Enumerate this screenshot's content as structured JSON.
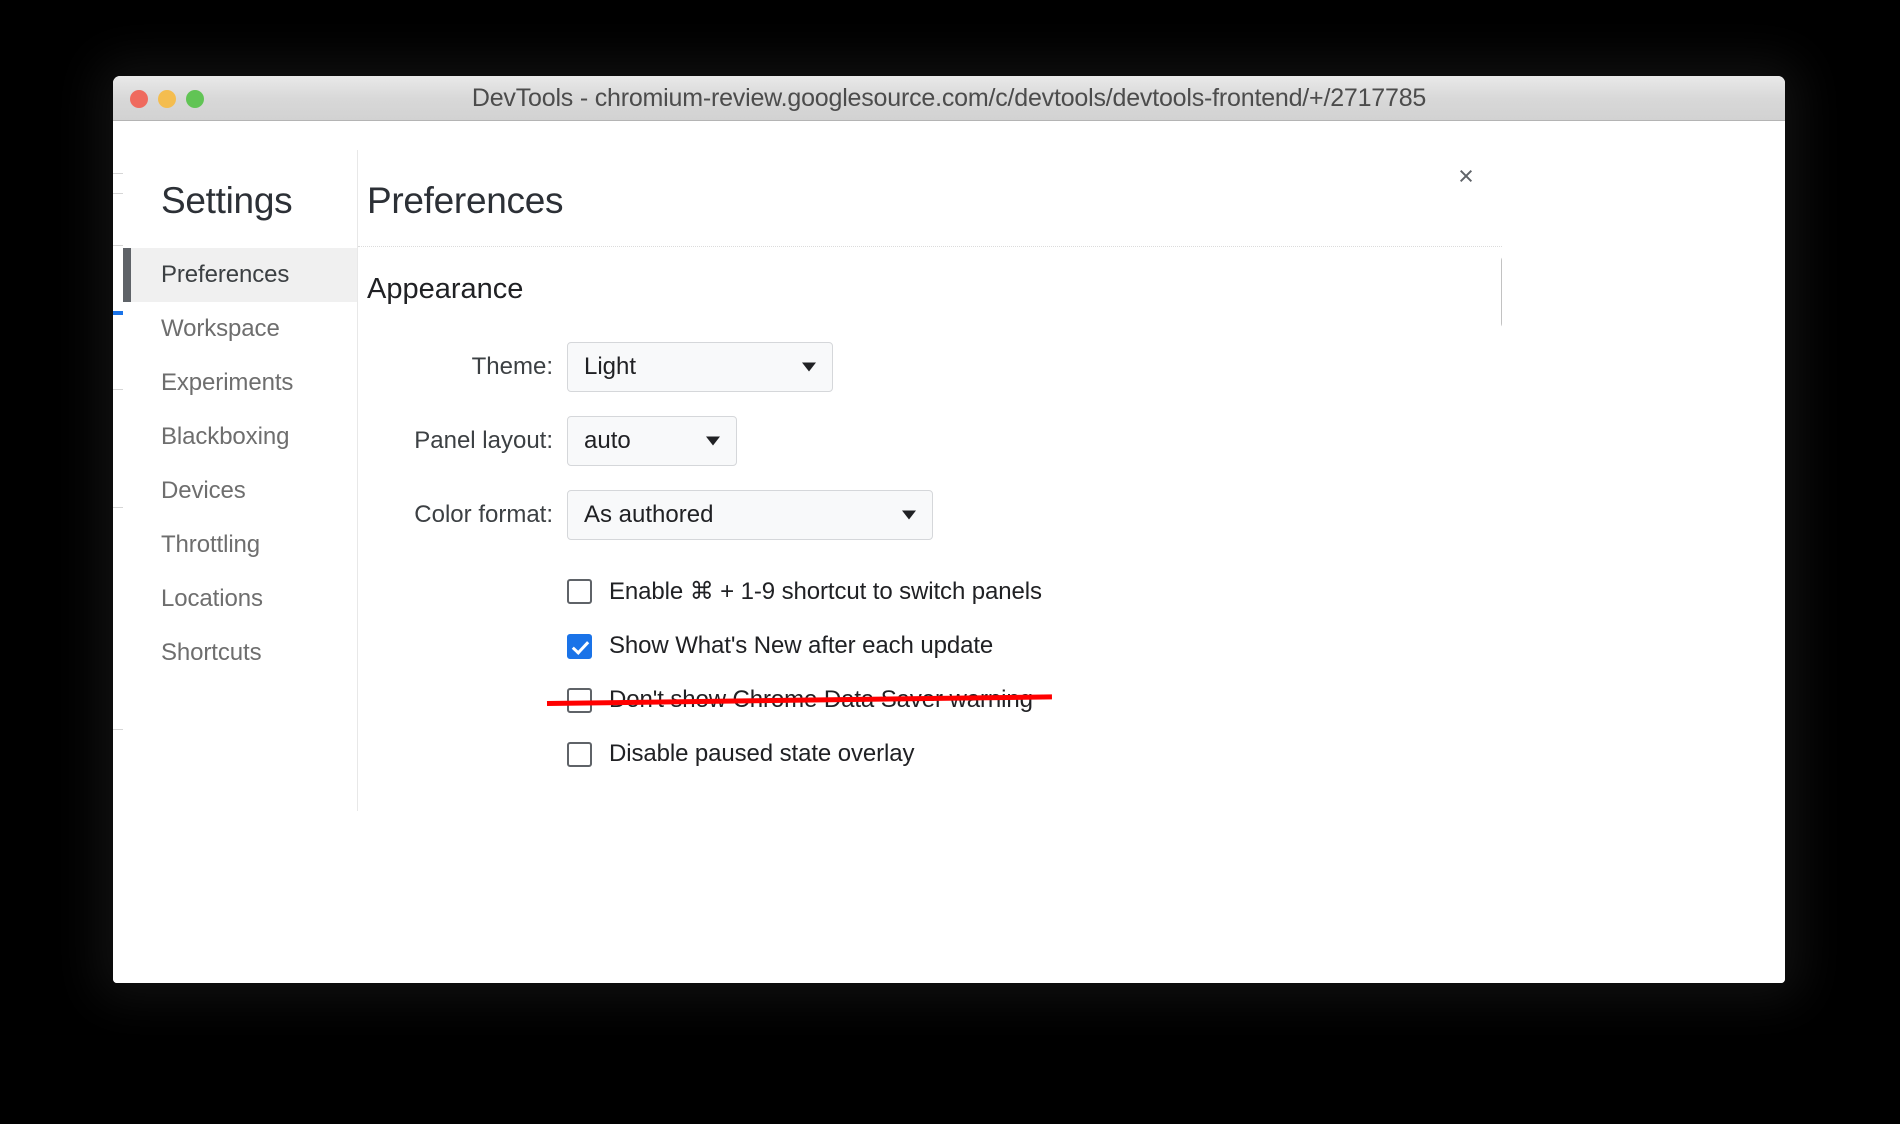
{
  "window": {
    "title": "DevTools - chromium-review.googlesource.com/c/devtools/devtools-frontend/+/2717785",
    "traffic_lights": {
      "close": "close-window",
      "minimize": "minimize-window",
      "zoom": "zoom-window"
    }
  },
  "dialog": {
    "close_label": "×"
  },
  "sidebar": {
    "title": "Settings",
    "items": [
      {
        "label": "Preferences",
        "selected": true
      },
      {
        "label": "Workspace",
        "selected": false
      },
      {
        "label": "Experiments",
        "selected": false
      },
      {
        "label": "Blackboxing",
        "selected": false
      },
      {
        "label": "Devices",
        "selected": false
      },
      {
        "label": "Throttling",
        "selected": false
      },
      {
        "label": "Locations",
        "selected": false
      },
      {
        "label": "Shortcuts",
        "selected": false
      }
    ]
  },
  "content": {
    "title": "Preferences",
    "section": "Appearance",
    "fields": [
      {
        "label": "Theme:",
        "value": "Light"
      },
      {
        "label": "Panel layout:",
        "value": "auto"
      },
      {
        "label": "Color format:",
        "value": "As authored"
      }
    ],
    "checkboxes": [
      {
        "label": "Enable ⌘ + 1-9 shortcut to switch panels",
        "checked": false,
        "struck": false
      },
      {
        "label": "Show What's New after each update",
        "checked": true,
        "struck": false
      },
      {
        "label": "Don't show Chrome Data Saver warning",
        "checked": false,
        "struck": true
      },
      {
        "label": "Disable paused state overlay",
        "checked": false,
        "struck": false
      }
    ]
  },
  "colors": {
    "accent": "#1a73e8",
    "strikethrough": "#ff0000",
    "selected_nav_bg": "#f0f0f0",
    "selected_nav_bar": "#5f6368",
    "traffic_red": "#ef6a5e",
    "traffic_yellow": "#f4bd4f",
    "traffic_green": "#61c455"
  }
}
